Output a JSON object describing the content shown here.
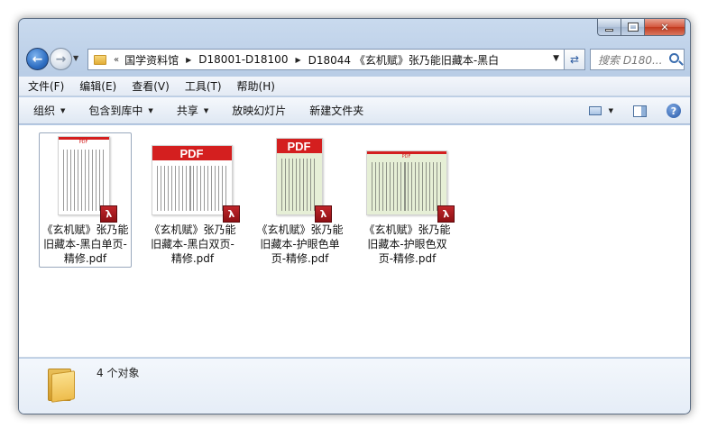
{
  "window": {
    "caption": {
      "minimize": "—",
      "maximize": "□",
      "close": "✕"
    }
  },
  "nav": {
    "back_icon": "arrow-left-icon",
    "forward_icon": "arrow-right-icon",
    "address": {
      "overflow": "«",
      "crumbs": [
        "国学资料馆",
        "D18001-D18100",
        "D18044 《玄机赋》张乃能旧藏本-黑白"
      ]
    },
    "search_placeholder": "搜索 D180..."
  },
  "menu": {
    "items": [
      "文件(F)",
      "编辑(E)",
      "查看(V)",
      "工具(T)",
      "帮助(H)"
    ]
  },
  "toolbar": {
    "organize": "组织",
    "include_in_library": "包含到库中",
    "share": "共享",
    "slideshow": "放映幻灯片",
    "new_folder": "新建文件夹",
    "help": "?"
  },
  "files": [
    {
      "name": "《玄机赋》张乃能旧藏本-黑白单页-精修.pdf",
      "thumb_header": "PDF",
      "style": "bw-single",
      "selected": true
    },
    {
      "name": "《玄机赋》张乃能旧藏本-黑白双页-精修.pdf",
      "thumb_header": "PDF",
      "style": "bw-double",
      "selected": false
    },
    {
      "name": "《玄机赋》张乃能旧藏本-护眼色单页-精修.pdf",
      "thumb_header": "PDF",
      "style": "eye-single",
      "selected": false
    },
    {
      "name": "《玄机赋》张乃能旧藏本-护眼色双页-精修.pdf",
      "thumb_header": "PDF",
      "style": "eye-double",
      "selected": false
    }
  ],
  "details": {
    "count": "4 个对象"
  },
  "colors": {
    "pdf_red": "#d41f1f",
    "eye_bg": "#e6efd6",
    "window_frame": "#b9cde6"
  }
}
